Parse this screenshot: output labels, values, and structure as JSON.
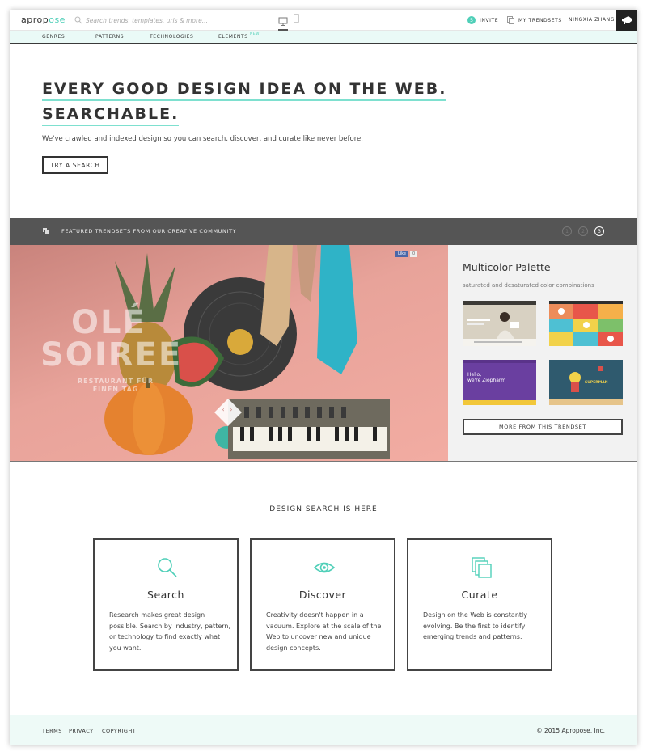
{
  "header": {
    "logo_main": "aprop",
    "logo_accent": "ose",
    "search_placeholder": "Search trends, templates, urls & more...",
    "invite_count": "5",
    "invite_label": "INVITE",
    "trendsets_label": "MY TRENDSETS",
    "user_name": "NINGXIA ZHANG"
  },
  "subnav": {
    "items": [
      "GENRES",
      "PATTERNS",
      "TECHNOLOGIES",
      "ELEMENTS"
    ],
    "new_badge": "NEW"
  },
  "hero": {
    "title_line1": "EVERY GOOD DESIGN IDEA ON THE WEB.",
    "title_line2": "SEARCHABLE.",
    "subtitle": "We've crawled and indexed design so you can search, discover, and curate like never before.",
    "cta_label": "TRY A SEARCH"
  },
  "featured": {
    "label": "FEATURED TRENDSETS FROM OUR CREATIVE COMMUNITY",
    "pages": [
      "1",
      "2",
      "3"
    ],
    "active_page": "3"
  },
  "showcase": {
    "headline_1": "OLÉ",
    "headline_2": "SOIREE",
    "tagline_1": "RESTAURANT FÜR",
    "tagline_2": "EINEN TAG",
    "like_label": "Like",
    "like_count": "0",
    "accent_colors": [
      "#c9837c",
      "#f2aca2"
    ]
  },
  "trendset": {
    "title": "Multicolor Palette",
    "description": "saturated and desaturated color combinations",
    "thumb3_text_1": "Hello,",
    "thumb3_text_2": "we're Ziopharm",
    "thumb4_text": "SUPERMAN",
    "more_label": "MORE FROM THIS TRENDSET"
  },
  "design_search": {
    "heading": "DESIGN SEARCH IS HERE",
    "cards": [
      {
        "icon": "magnifier-icon",
        "title": "Search",
        "text": "Research makes great design possible. Search by industry, pattern, or technology to find exactly what you want."
      },
      {
        "icon": "eye-icon",
        "title": "Discover",
        "text": "Creativity doesn't happen in a vacuum. Explore at the scale of the Web to uncover new and unique design concepts."
      },
      {
        "icon": "stack-icon",
        "title": "Curate",
        "text": "Design on the Web is constantly evolving. Be the first to identify emerging trends and patterns."
      }
    ]
  },
  "footer": {
    "links": [
      "TERMS",
      "PRIVACY",
      "COPYRIGHT"
    ],
    "copyright": "© 2015 Apropose, Inc."
  },
  "colors": {
    "accent": "#4fcfb8",
    "dark_bar": "#555555",
    "panel": "#f2f2f2",
    "footer_bg": "#eefaf7"
  }
}
